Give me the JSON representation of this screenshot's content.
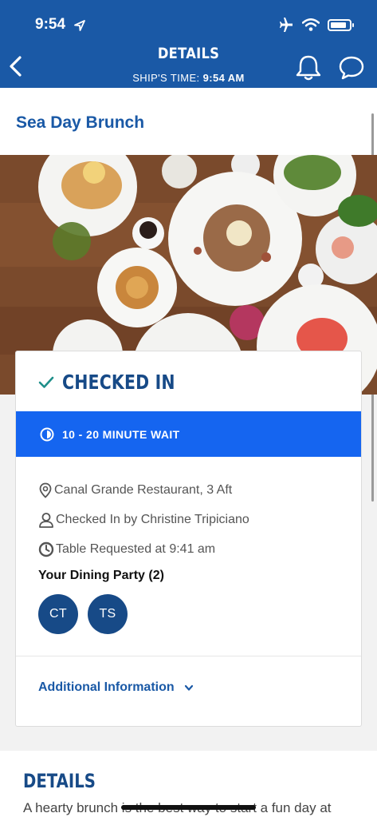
{
  "status_bar": {
    "time": "9:54"
  },
  "header": {
    "title": "DETAILS",
    "ships_time_label": "SHIP'S TIME:",
    "ships_time_value": "9:54 AM"
  },
  "event": {
    "title": "Sea Day Brunch"
  },
  "checkin": {
    "status": "CHECKED IN",
    "wait": "10 - 20 MINUTE WAIT",
    "location": "Canal Grande Restaurant, 3 Aft",
    "checked_in_by": "Checked In by Christine Tripiciano",
    "table_requested": "Table Requested at 9:41 am",
    "party_heading": "Your Dining Party (2)",
    "party": [
      {
        "initials": "CT"
      },
      {
        "initials": "TS"
      }
    ],
    "additional_info": "Additional Information"
  },
  "details": {
    "heading": "DETAILS",
    "text": "A hearty brunch is the best way to start a fun day at"
  },
  "colors": {
    "header_blue": "#1a59a6",
    "wait_blue": "#1565f0",
    "navy": "#174a87",
    "check_teal": "#1f8f8a"
  }
}
